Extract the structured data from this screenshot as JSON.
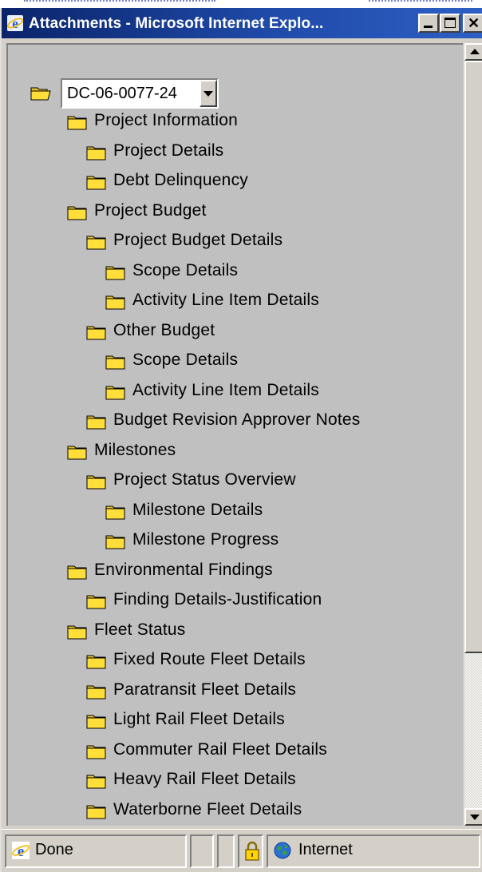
{
  "window": {
    "title": "Attachments - Microsoft Internet Explo...",
    "close_glyph": "✕"
  },
  "root": {
    "selected_value": "DC-06-0077-24"
  },
  "tree": [
    {
      "label": "Project Information",
      "level": 1
    },
    {
      "label": "Project Details",
      "level": 2
    },
    {
      "label": "Debt Delinquency",
      "level": 2
    },
    {
      "label": "Project Budget",
      "level": 1
    },
    {
      "label": "Project Budget Details",
      "level": 2
    },
    {
      "label": "Scope Details",
      "level": 3
    },
    {
      "label": "Activity Line Item Details",
      "level": 3
    },
    {
      "label": "Other Budget",
      "level": 2
    },
    {
      "label": "Scope Details",
      "level": 3
    },
    {
      "label": "Activity Line Item Details",
      "level": 3
    },
    {
      "label": "Budget Revision Approver Notes",
      "level": 2
    },
    {
      "label": "Milestones",
      "level": 1
    },
    {
      "label": "Project Status Overview",
      "level": 2
    },
    {
      "label": "Milestone Details",
      "level": 3
    },
    {
      "label": "Milestone Progress",
      "level": 3
    },
    {
      "label": "Environmental Findings",
      "level": 1
    },
    {
      "label": "Finding Details-Justification",
      "level": 2
    },
    {
      "label": "Fleet Status",
      "level": 1
    },
    {
      "label": "Fixed Route Fleet Details",
      "level": 2
    },
    {
      "label": "Paratransit Fleet Details",
      "level": 2
    },
    {
      "label": "Light Rail Fleet Details",
      "level": 2
    },
    {
      "label": "Commuter Rail Fleet Details",
      "level": 2
    },
    {
      "label": "Heavy Rail Fleet Details",
      "level": 2
    },
    {
      "label": "Waterborne Fleet Details",
      "level": 2
    }
  ],
  "status": {
    "left_text": "Done",
    "zone_text": "Internet"
  },
  "icons": {
    "folder": "folder-icon",
    "open_folder": "folder-open-icon",
    "browser": "internet-explorer-icon",
    "lock": "lock-icon",
    "globe": "globe-icon"
  },
  "colors": {
    "titlebar_start": "#0a246a",
    "titlebar_end": "#2d5fc4",
    "folder_fill": "#ffde39",
    "folder_edge": "#000000",
    "content_bg": "#c0c0c0"
  }
}
